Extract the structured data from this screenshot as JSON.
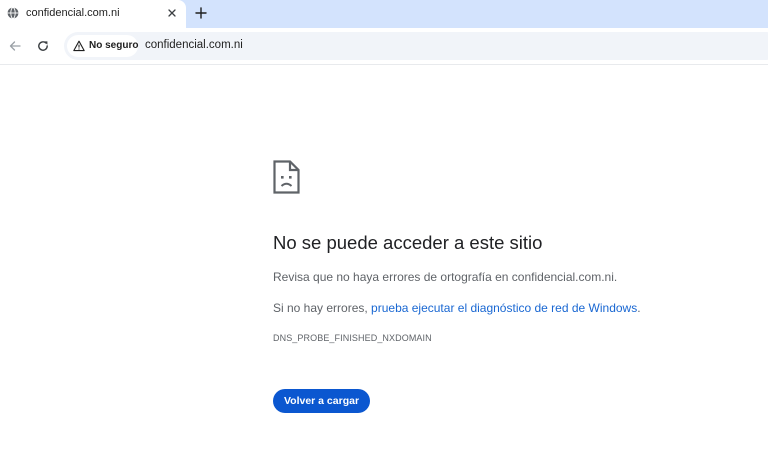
{
  "tab": {
    "title": "confidencial.com.ni",
    "favicon": "globe-icon",
    "close_icon": "close-icon"
  },
  "new_tab_icon": "plus-icon",
  "toolbar": {
    "back_icon": "arrow-back-icon",
    "reload_icon": "reload-icon",
    "security": {
      "icon": "warning-triangle-icon",
      "label": "No seguro"
    },
    "url": "confidencial.com.ni"
  },
  "error_page": {
    "icon": "sad-document-icon",
    "title": "No se puede acceder a este sitio",
    "message": "Revisa que no haya errores de ortografía en confidencial.com.ni.",
    "suggestion_prefix": "Si no hay errores, ",
    "suggestion_link": "prueba ejecutar el diagnóstico de red de Windows",
    "suggestion_suffix": ".",
    "error_code": "DNS_PROBE_FINISHED_NXDOMAIN",
    "reload_label": "Volver a cargar"
  },
  "colors": {
    "tabstrip": "#d3e3fd",
    "link": "#1967d2",
    "button": "#0b57d0"
  }
}
